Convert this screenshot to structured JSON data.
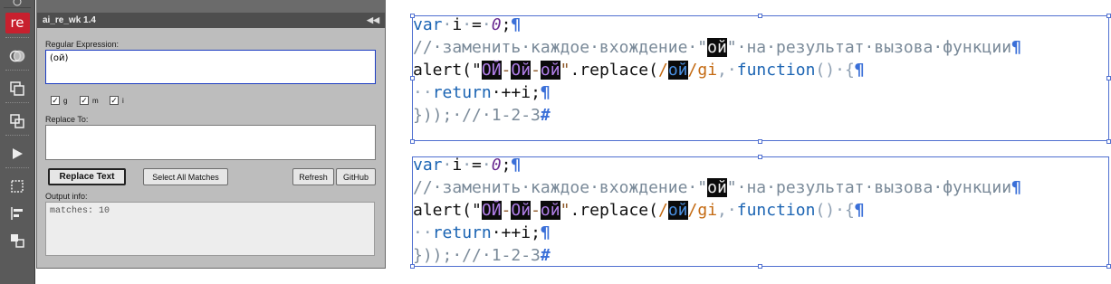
{
  "panel": {
    "title": "ai_re_wk 1.4",
    "collapse_icon": "double-left-arrow",
    "regex_label": "Regular Expression:",
    "regex_value": "(ой)",
    "flags": [
      {
        "label": "g",
        "checked": true
      },
      {
        "label": "m",
        "checked": true
      },
      {
        "label": "i",
        "checked": true
      }
    ],
    "replace_label": "Replace To:",
    "replace_value": "",
    "replace_button": "Replace Text",
    "select_all_button": "Select All Matches",
    "refresh_button": "Refresh",
    "github_button": "GitHub",
    "output_label": "Output info:",
    "output_value": "matches: 10"
  },
  "toolbar": {
    "logo_text": "re",
    "icons": [
      "adobe-logo-icon",
      "re-logo-icon",
      "overlap-circles-icon",
      "layer-stack-icon",
      "duplicate-icon",
      "play-icon",
      "selection-crop-icon",
      "align-left-icon",
      "arrange-icon"
    ]
  },
  "code_blocks": [
    {
      "line1": [
        "var",
        "·",
        "i",
        "·",
        "=",
        "·",
        "0",
        ";",
        "¶"
      ],
      "line2_a": "//·заменить·каждое·вхождение·\"",
      "line2_match": "ой",
      "line2_b": "\"·на·результат·вызова·функции",
      "line3_a": "alert(\"",
      "line3_m1": "ОЙ",
      "line3_d1": "-",
      "line3_m2": "Ой",
      "line3_d2": "-",
      "line3_m3": "ой",
      "line3_b": "\"",
      "line3_c": ".replace(",
      "line3_d": "/",
      "line3_m4": "ой",
      "line3_e": "/gi",
      "line3_f": ",·",
      "line3_g": "function",
      "line3_h": "()·{",
      "line4_a": "··",
      "line4_b": "return",
      "line4_c": "·++i;",
      "line5": "}));·//·1-2-3",
      "pilcrow": "¶",
      "end_mark": "#"
    },
    {
      "line1": [
        "var",
        "·",
        "i",
        "·",
        "=",
        "·",
        "0",
        ";",
        "¶"
      ],
      "line2_a": "//·заменить·каждое·вхождение·\"",
      "line2_match": "ой",
      "line2_b": "\"·на·результат·вызова·функции",
      "line3_a": "alert(\"",
      "line3_m1": "ОЙ",
      "line3_d1": "-",
      "line3_m2": "Ой",
      "line3_d2": "-",
      "line3_m3": "ой",
      "line3_b": "\"",
      "line3_c": ".replace(",
      "line3_d": "/",
      "line3_m4": "ой",
      "line3_e": "/gi",
      "line3_f": ",·",
      "line3_g": "function",
      "line3_h": "()·{",
      "line4_a": "··",
      "line4_b": "return",
      "line4_c": "·++i;",
      "line5": "}));·//·1-2-3",
      "pilcrow": "¶",
      "end_mark": "#"
    }
  ]
}
